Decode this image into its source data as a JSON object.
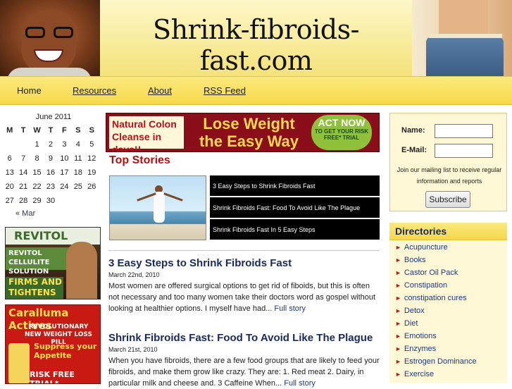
{
  "header": {
    "site_title": "Shrink-fibroids-fast.com"
  },
  "nav": {
    "items": [
      {
        "label": "Home"
      },
      {
        "label": "Resources"
      },
      {
        "label": "About"
      },
      {
        "label": "RSS Feed"
      }
    ]
  },
  "calendar": {
    "caption": "June 2011",
    "weekdays": [
      "M",
      "T",
      "W",
      "T",
      "F",
      "S",
      "S"
    ],
    "weeks": [
      [
        "",
        "",
        "1",
        "2",
        "3",
        "4",
        "5"
      ],
      [
        "6",
        "7",
        "8",
        "9",
        "10",
        "11",
        "12"
      ],
      [
        "13",
        "14",
        "15",
        "16",
        "17",
        "18",
        "19"
      ],
      [
        "20",
        "21",
        "22",
        "23",
        "24",
        "25",
        "26"
      ],
      [
        "27",
        "28",
        "29",
        "30",
        "",
        "",
        ""
      ]
    ],
    "prev": "« Mar"
  },
  "ads": {
    "revitol": {
      "logo": "REVITOL",
      "bar": "REVITOL CELLULITE SOLUTION",
      "tag": "FIRMS AND TIGHTENS SKIN"
    },
    "caralluma": {
      "title": "Caralluma Actives",
      "sub": "REVOLUTIONARY NEW WEIGHT LOSS PILL",
      "suppress": "Suppress your Appetite",
      "risk": "RISK FREE TRIAL*"
    }
  },
  "banner": {
    "left": "Natural Colon Cleanse in days!!",
    "mid": "Lose Weight the Easy Way",
    "act_big": "ACT NOW",
    "act_small": "TO GET YOUR RISK FREE* TRIAL"
  },
  "top_stories": {
    "heading": "Top Stories",
    "items": [
      {
        "title": "3 Easy Steps to Shrink Fibroids Fast"
      },
      {
        "title": "Shrink Fibroids Fast: Food To Avoid Like The Plague"
      },
      {
        "title": "Shrink Fibroids Fast In 5 Easy Steps"
      }
    ]
  },
  "articles": [
    {
      "title": "3 Easy Steps to Shrink Fibroids Fast",
      "date": "March 22nd, 2010",
      "body": "Most women are offered surgical options to get rid of fiboids, but this is often not necessary and too many women take their doctors word as gospel without looking at healthier options. I myself have had...",
      "more": "Full story"
    },
    {
      "title": "Shrink Fibroids Fast: Food To Avoid Like The Plague",
      "date": "March 21st, 2010",
      "body": "When you have fibroids, there are a few food groups that are likely to feed your fibroids, and make them grow like crazy. They are: 1. Red meat 2. Dairy, in particular milk and cheese and. 3 Caffeine When...",
      "more": "Full story"
    }
  ],
  "signup": {
    "name_label": "Name:",
    "email_label": "E-Mail:",
    "text": "Join our mailing list to receive regular information and reports",
    "button": "Subscribe"
  },
  "directories": {
    "heading": "Directories",
    "items": [
      "Acupuncture",
      "Books",
      "Castor Oil Pack",
      "Constipation",
      "constipation cures",
      "Detox",
      "Diet",
      "Emotions",
      "Enzymes",
      "Estrogen Dominance",
      "Exercise"
    ]
  }
}
